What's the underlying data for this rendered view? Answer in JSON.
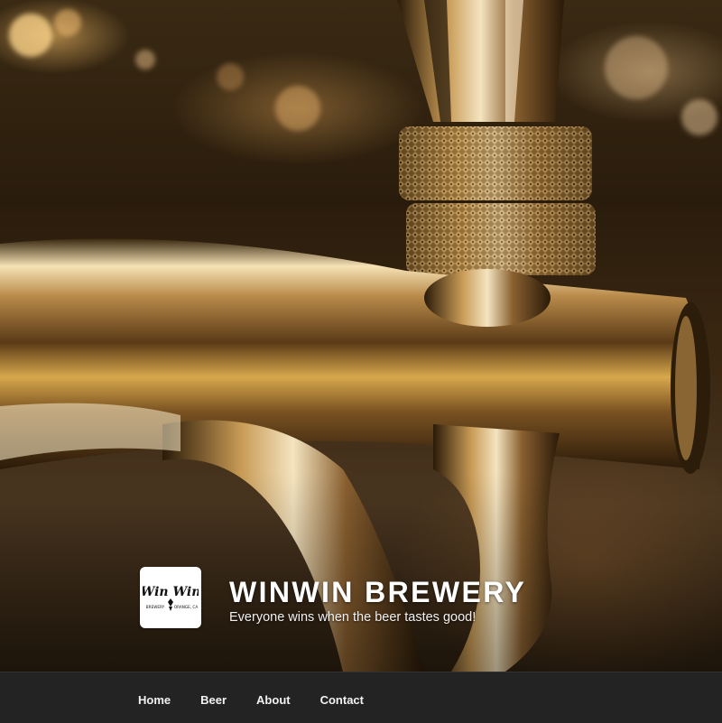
{
  "site": {
    "title": "WINWIN BREWERY",
    "tagline": "Everyone wins when the beer tastes good!",
    "logo": {
      "script_text": "Win Win",
      "sub_left": "BREWERY",
      "sub_right": "ORANGE, CA",
      "icon": "hop-icon"
    }
  },
  "hero": {
    "image": "beer-tap-photo"
  },
  "nav": {
    "items": [
      {
        "label": "Home"
      },
      {
        "label": "Beer"
      },
      {
        "label": "About"
      },
      {
        "label": "Contact"
      }
    ]
  },
  "colors": {
    "navbar_bg": "#232323",
    "nav_text": "#f2f2f2",
    "title_text": "#ffffff",
    "logo_bg": "#ffffff"
  }
}
